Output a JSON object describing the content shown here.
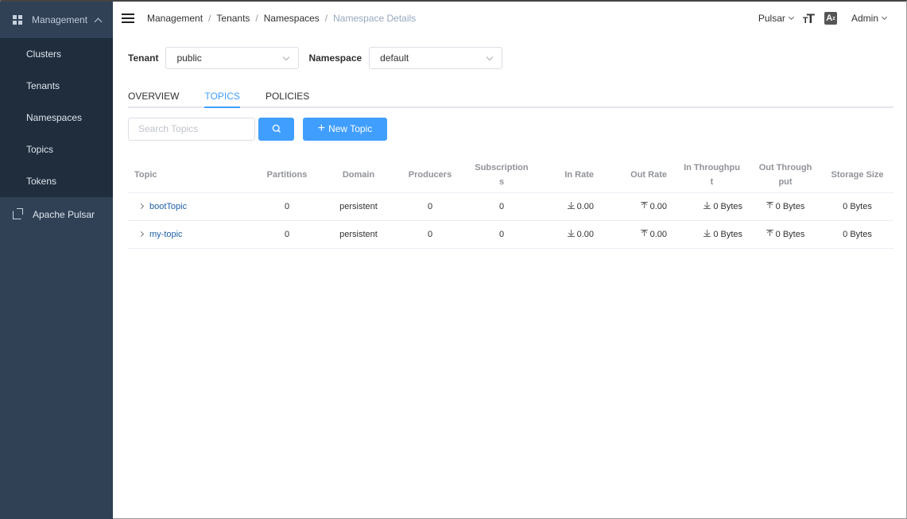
{
  "sidebar": {
    "group_label": "Management",
    "items": [
      {
        "label": "Clusters"
      },
      {
        "label": "Tenants"
      },
      {
        "label": "Namespaces"
      },
      {
        "label": "Topics"
      },
      {
        "label": "Tokens"
      }
    ],
    "external_link": "Apache Pulsar"
  },
  "header": {
    "breadcrumb": [
      "Management",
      "Tenants",
      "Namespaces",
      "Namespace Details"
    ],
    "separator": "/",
    "env": "Pulsar",
    "lang_icon_text": "A",
    "user": "Admin"
  },
  "filters": {
    "tenant_label": "Tenant",
    "tenant_value": "public",
    "namespace_label": "Namespace",
    "namespace_value": "default"
  },
  "tabs": [
    {
      "label": "OVERVIEW",
      "active": false
    },
    {
      "label": "TOPICS",
      "active": true
    },
    {
      "label": "POLICIES",
      "active": false
    }
  ],
  "toolbar": {
    "search_placeholder": "Search Topics",
    "new_topic_label": "New Topic"
  },
  "table": {
    "columns": [
      "Topic",
      "Partitions",
      "Domain",
      "Producers",
      "Subscriptions",
      "In Rate",
      "Out Rate",
      "In Throughput",
      "Out Throughput",
      "Storage Size"
    ],
    "column_display": [
      "Topic",
      "Partitions",
      "Domain",
      "Producers",
      "Subscription\ns",
      "In Rate",
      "Out Rate",
      "In Throughpu\nt",
      "Out Through\nput",
      "Storage Size"
    ],
    "rows": [
      {
        "topic": "bootTopic",
        "partitions": "0",
        "domain": "persistent",
        "producers": "0",
        "subscriptions": "0",
        "in_rate": "0.00",
        "out_rate": "0.00",
        "in_throughput": "0 Bytes",
        "out_throughput": "0 Bytes",
        "storage_size": "0 Bytes"
      },
      {
        "topic": "my-topic",
        "partitions": "0",
        "domain": "persistent",
        "producers": "0",
        "subscriptions": "0",
        "in_rate": "0.00",
        "out_rate": "0.00",
        "in_throughput": "0 Bytes",
        "out_throughput": "0 Bytes",
        "storage_size": "0 Bytes"
      }
    ]
  },
  "colors": {
    "sidebar_bg": "#304156",
    "sidebar_sub_bg": "#1f2d3d",
    "primary": "#409eff",
    "link": "#1f5fa8"
  }
}
